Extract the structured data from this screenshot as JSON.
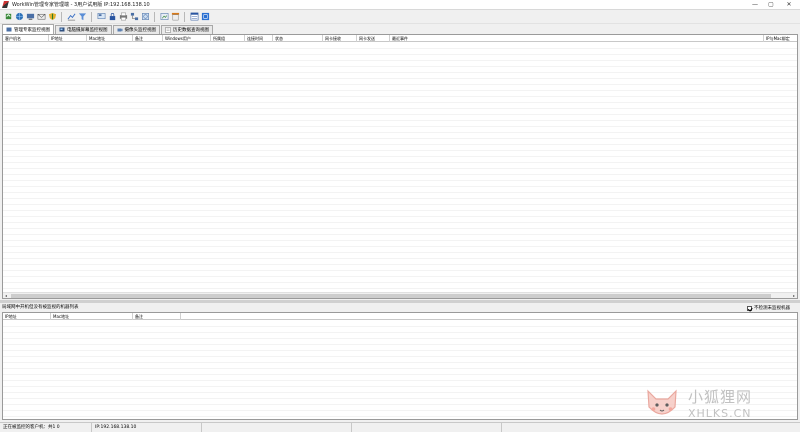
{
  "window": {
    "title": "WorkWin管理专家管理端 - 3用户试用版 IP:192.168.138.10",
    "minimize": "—",
    "maximize": "▢",
    "close": "✕"
  },
  "toolbar": {
    "icons": [
      "refresh-icon",
      "globe-icon",
      "monitor-icon",
      "mail-icon",
      "shield-icon",
      "chart-icon",
      "filter-icon",
      "screen-icon",
      "lock-icon",
      "printer-icon",
      "network-icon",
      "history-icon",
      "capture-icon",
      "download-icon",
      "window-icon",
      "help-icon"
    ]
  },
  "tabs": [
    {
      "label": "管理专家监控视图"
    },
    {
      "label": "电脑摄屏幕监控视图"
    },
    {
      "label": "摄像头监控视图"
    },
    {
      "label": "历史数据查询视图"
    }
  ],
  "main_table": {
    "headers": [
      "客户机名",
      "IP地址",
      "Mac地址",
      "备注",
      "Windows用户",
      "所属组",
      "连接时间",
      "状态",
      "网卡接收",
      "网卡发送",
      "最近事件",
      "IP与Mac绑定"
    ],
    "rows": []
  },
  "bottom_section": {
    "label": "局域网中开机但没有被监视的机器列表",
    "checkbox_label": "不检测未监视机器",
    "checkbox_checked": true,
    "headers": [
      "IP地址",
      "Mac地址",
      "备注"
    ],
    "rows": []
  },
  "statusbar": {
    "left": "正在被监控的客户机：共1 0",
    "ip": "IP:192.168.138.10",
    "cell3": "",
    "cell4": "",
    "cell5": ""
  },
  "watermark": {
    "cn": "小狐狸网",
    "en": "XHLKS.CN"
  },
  "colors": {
    "window_bg": "#f0f0f0",
    "grid_bg": "#ffffff",
    "border": "#9a9a9a"
  }
}
